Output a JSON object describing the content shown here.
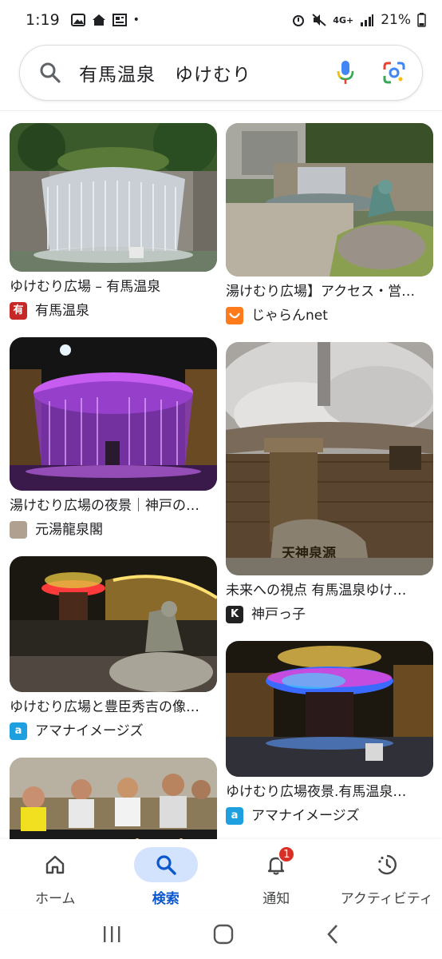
{
  "status_bar": {
    "time": "1:19",
    "dot": "•",
    "network": "4G+",
    "battery": "21%"
  },
  "search": {
    "query": "有馬温泉　ゆけむり"
  },
  "results_left": [
    {
      "title": "ゆけむり広場 – 有馬温泉",
      "source": "有馬温泉",
      "favicon_text": "有",
      "favicon_color": "#c62828"
    },
    {
      "title": "湯けむり広場の夜景｜神戸の…",
      "source": "元湯龍泉閣",
      "favicon_text": "",
      "favicon_color": "#b0a090"
    },
    {
      "title": "ゆけむり広場と豊臣秀吉の像…",
      "source": "アマナイメージズ",
      "favicon_text": "a",
      "favicon_color": "#1ea0e0"
    },
    {
      "title": "",
      "source": "",
      "favicon_text": "",
      "favicon_color": "#ffffff"
    }
  ],
  "results_right": [
    {
      "title": "湯けむり広場】アクセス・営…",
      "source": "じゃらんnet",
      "favicon_text": "",
      "favicon_color": "#ff7a1a"
    },
    {
      "title": "未来への視点 有馬温泉ゆけ…",
      "source": "神戸っ子",
      "favicon_text": "K",
      "favicon_color": "#222222"
    },
    {
      "title": "ゆけむり広場夜景.有馬温泉…",
      "source": "アマナイメージズ",
      "favicon_text": "a",
      "favicon_color": "#1ea0e0"
    }
  ],
  "image_overlays": {
    "stone_text": "天神泉源"
  },
  "bottom_nav": {
    "items": [
      {
        "label": "ホーム",
        "icon": "home-icon"
      },
      {
        "label": "検索",
        "icon": "search-icon"
      },
      {
        "label": "通知",
        "icon": "bell-icon"
      },
      {
        "label": "アクティビティ",
        "icon": "activity-icon"
      }
    ],
    "badge": "1"
  }
}
